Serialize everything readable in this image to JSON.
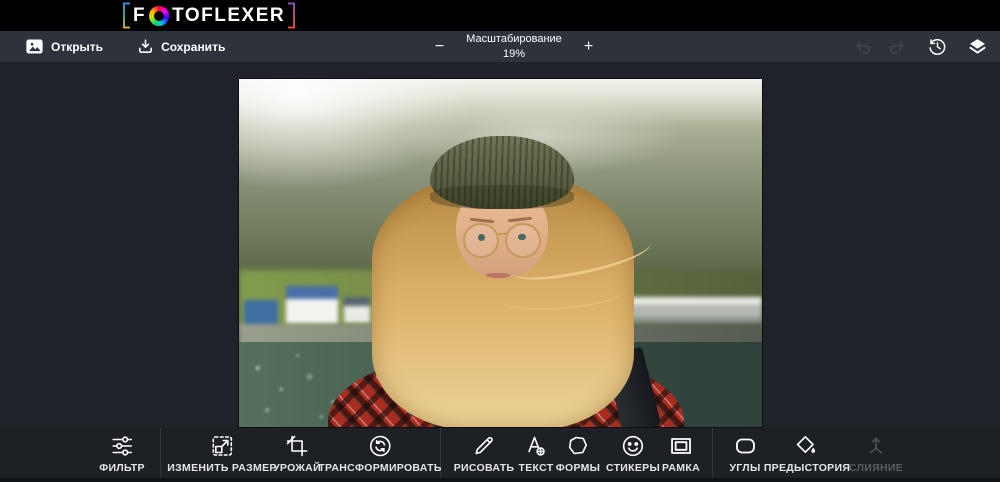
{
  "brand": {
    "name_prefix": "F",
    "name_suffix": "TOFLEXER",
    "bracket_left_colors": [
      "#3d87d6",
      "#2fa98c",
      "#d2ab2c"
    ],
    "bracket_right_colors": [
      "#8a50b5",
      "#e0452f"
    ]
  },
  "toolbar": {
    "open_label": "Открыть",
    "save_label": "Сохранить",
    "zoom": {
      "label": "Масштабирование",
      "value": "19%",
      "zoom_out": "−",
      "zoom_in": "+"
    },
    "history_tools": [
      "undo",
      "redo",
      "history",
      "layers"
    ]
  },
  "canvas": {
    "photo_description": "Portrait of a woman with long blonde wind-blown hair, round glasses and olive-green ribbed beanie, wearing a red and black plaid shirt, standing before blurred green mountains, a white house with blue roof, harbor buildings and dark teal water"
  },
  "bottom_toolbar": {
    "items": [
      {
        "label": "ФИЛЬТР",
        "icon": "filter-icon",
        "enabled": true
      },
      {
        "label": "ИЗМЕНИТЬ РАЗМЕР",
        "icon": "resize-icon",
        "enabled": true
      },
      {
        "label": "УРОЖАЙ",
        "icon": "crop-icon",
        "enabled": true
      },
      {
        "label": "ТРАНСФОРМИРОВАТЬ",
        "icon": "transform-icon",
        "enabled": true
      },
      {
        "label": "РИСОВАТЬ",
        "icon": "draw-icon",
        "enabled": true
      },
      {
        "label": "ТЕКСТ",
        "icon": "text-icon",
        "enabled": true
      },
      {
        "label": "ФОРМЫ",
        "icon": "shapes-icon",
        "enabled": true
      },
      {
        "label": "СТИКЕРЫ",
        "icon": "stickers-icon",
        "enabled": true
      },
      {
        "label": "РАМКА",
        "icon": "frame-icon",
        "enabled": true
      },
      {
        "label": "УГЛЫ",
        "icon": "corners-icon",
        "enabled": true
      },
      {
        "label": "ПРЕДЫСТОРИЯ",
        "icon": "background-icon",
        "enabled": true
      },
      {
        "label": "СЛИЯНИЕ",
        "icon": "merge-icon",
        "enabled": false
      }
    ]
  },
  "colors": {
    "topbar_bg": "#000000",
    "toolbar_bg": "#2e323a",
    "canvas_bg": "#1f2329",
    "bottombar_bg": "#1d2126",
    "text": "#ffffff",
    "disabled_text": "#585d64"
  }
}
